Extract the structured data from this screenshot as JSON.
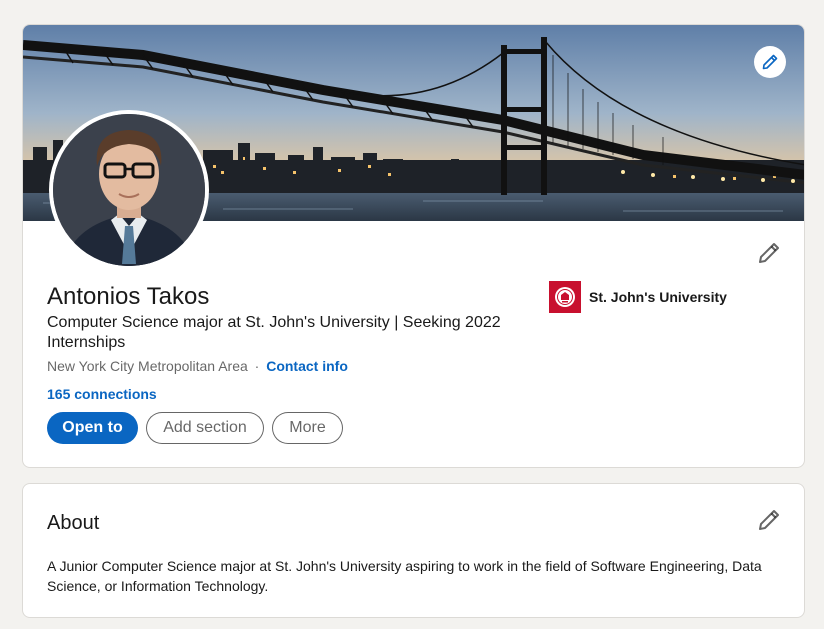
{
  "profile": {
    "name": "Antonios Takos",
    "headline": "Computer Science major at St. John's University | Seeking 2022 Internships",
    "location": "New York City Metropolitan Area",
    "separator": "·",
    "contact_info_label": "Contact info",
    "connections_label": "165 connections",
    "actions": {
      "open_to": "Open to",
      "add_section": "Add section",
      "more": "More"
    },
    "education": {
      "school": "St. John's University"
    },
    "banner_edit_icon": "pencil-icon",
    "intro_edit_icon": "pencil-icon"
  },
  "about": {
    "title": "About",
    "text": "A Junior Computer Science major at St. John's University aspiring to work in the field of Software Engineering, Data Science, or Information Technology.",
    "edit_icon": "pencil-icon"
  },
  "colors": {
    "primary_blue": "#0a66c2",
    "school_red": "#c8102e",
    "page_bg": "#f3f2ef"
  }
}
